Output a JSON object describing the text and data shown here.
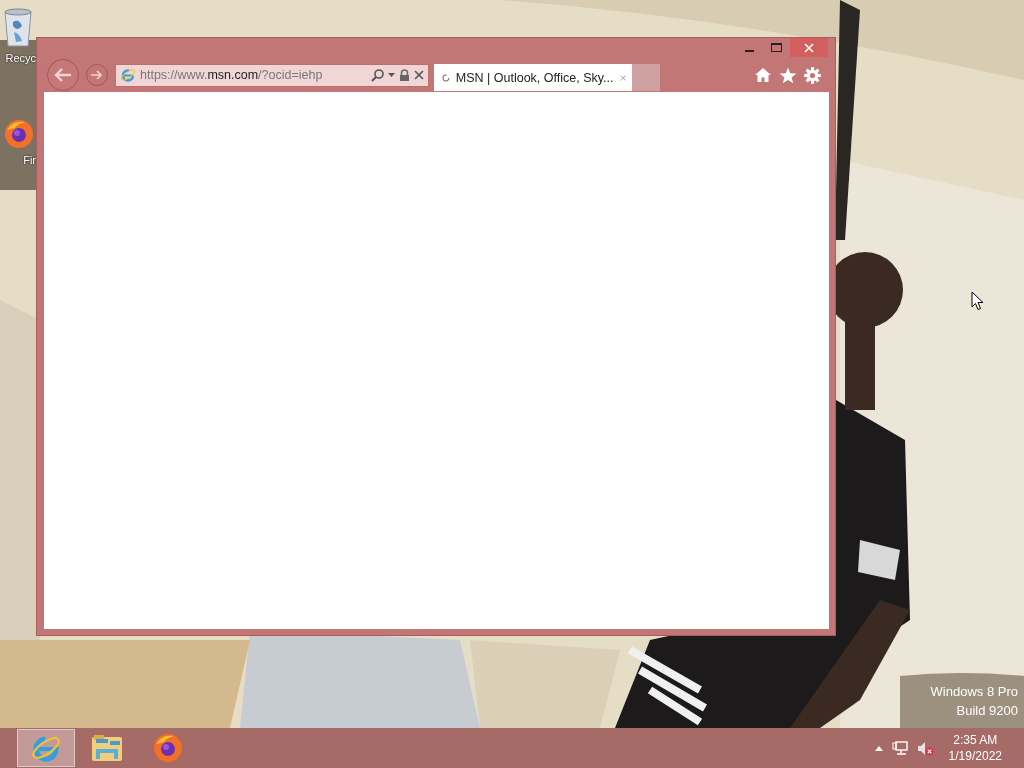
{
  "desktop_icons": [
    {
      "kind": "recycle-bin",
      "label": "Recyc"
    },
    {
      "kind": "firefox",
      "label": "Fir"
    }
  ],
  "browser": {
    "address": {
      "prefix": "https://www.",
      "domain": "msn.com",
      "suffix": "/?ocid=iehp"
    },
    "tabs": [
      {
        "title": "MSN | Outlook, Office, Sky...",
        "selected": true,
        "loading": true
      }
    ]
  },
  "os_watermark": [
    "Windows 8 Pro",
    "Build 9200"
  ],
  "taskbar": {
    "pinned": [
      {
        "kind": "ie",
        "selected": true
      },
      {
        "kind": "explorer",
        "selected": false
      },
      {
        "kind": "firefox",
        "selected": false
      }
    ],
    "volume_muted": true,
    "time": "2:35 AM",
    "date": "1/19/2022"
  }
}
